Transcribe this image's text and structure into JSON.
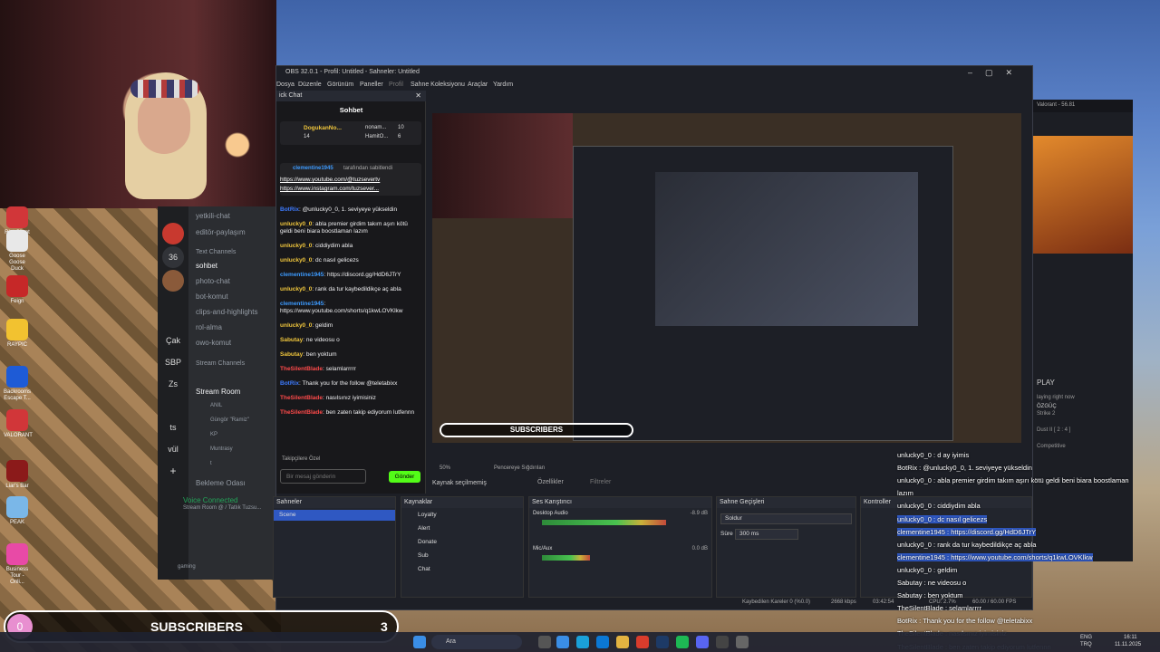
{
  "desktop": {
    "icons": [
      {
        "label": "Riot Client",
        "color": "#d13639"
      },
      {
        "label": "Goose Goose Duck",
        "color": "#e8e8e8"
      },
      {
        "label": "Feign",
        "color": "#c62828"
      },
      {
        "label": "RAYPIC",
        "color": "#f2c230"
      },
      {
        "label": "Backrooms Escape T...",
        "color": "#1e5bd6"
      },
      {
        "label": "VALORANT",
        "color": "#d13639"
      },
      {
        "label": "Liar's Bar",
        "color": "#8b1a1a"
      },
      {
        "label": "PEAK",
        "color": "#7ab7e8"
      },
      {
        "label": "Business Tour - Onli...",
        "color": "#e84aa6"
      }
    ]
  },
  "discord": {
    "servers": [
      "Çak",
      "36",
      "SBP",
      "Zs",
      "ts",
      "vül"
    ],
    "channels": [
      {
        "label": "yetkili-chat",
        "selected": false
      },
      {
        "label": "editör-paylaşım",
        "selected": false
      },
      {
        "label": "sohbet",
        "selected": true
      },
      {
        "label": "photo-chat",
        "selected": false
      },
      {
        "label": "bot-komut",
        "selected": false
      },
      {
        "label": "clips-and-highlights",
        "selected": false
      },
      {
        "label": "rol-alma",
        "selected": false
      },
      {
        "label": "owo-komut",
        "selected": false
      }
    ],
    "text_channels_label": "Text Channels",
    "stream_channels_label": "Stream Channels",
    "stream_room": "Stream Room",
    "voice_members": [
      "ANIL",
      "Güngör \"Ramiz\"",
      "KP",
      "Muntrasy",
      "t"
    ],
    "bekleme": "Bekleme Odası",
    "voice_connected": "Voice Connected",
    "voice_sub": "Stream Room @ / Tatlık Tuzsu...",
    "user_status": "gaming"
  },
  "obs": {
    "title": "OBS 32.0.1 - Profil: Untitled - Sahneler: Untitled",
    "menu": [
      "Dosya",
      "Düzenle",
      "Görünüm",
      "Paneller",
      "Profil",
      "Sahne Koleksiyonu",
      "Araçlar",
      "Yardım"
    ],
    "chat_dock_title": "ick Chat",
    "chat_header": "Sohbet",
    "leaderboard": [
      {
        "name": "DogukanNo...",
        "count": "14"
      },
      {
        "name": "nonam...",
        "count": "10"
      },
      {
        "name": "HamitO...",
        "count": "6"
      }
    ],
    "pinned": {
      "user": "clementine1945",
      "note": "tarafından sabitlendi",
      "link1": "https://www.youtube.com/@tuzsevertv",
      "link2": "https://www.instagram.com/tuzsever..."
    },
    "messages": [
      {
        "user": "BotRix",
        "color": "#3d7bff",
        "text": ": @unlucky0_0, 1. seviyeye yükseldin"
      },
      {
        "user": "unlucky0_0",
        "color": "#f0c63c",
        "text": ": abla premier girdim takım aşırı kötü geldi beni biara boostlaman lazım"
      },
      {
        "user": "unlucky0_0",
        "color": "#f0c63c",
        "text": ": ciddiydim abla"
      },
      {
        "user": "unlucky0_0",
        "color": "#f0c63c",
        "text": ": dc nasıl gelicezs"
      },
      {
        "user": "clementine1945",
        "color": "#3d9bff",
        "text": ": https://discord.gg/HdD6JTrY"
      },
      {
        "user": "unlucky0_0",
        "color": "#f0c63c",
        "text": ": rank da tur kaybedildikçe aç abla"
      },
      {
        "user": "clementine1945",
        "color": "#3d9bff",
        "text": ": https://www.youtube.com/shorts/q1kwLOVKlkw"
      },
      {
        "user": "unlucky0_0",
        "color": "#f0c63c",
        "text": ": geldim"
      },
      {
        "user": "Sabutay",
        "color": "#f0c63c",
        "text": ": ne videosu o"
      },
      {
        "user": "Sabutay",
        "color": "#f0c63c",
        "text": ": ben yoktum"
      },
      {
        "user": "TheSilentBlade",
        "color": "#ff4a4a",
        "text": ": selamlarrrrr"
      },
      {
        "user": "BotRix",
        "color": "#3d7bff",
        "text": ": Thank you for the follow @teletabixx"
      },
      {
        "user": "TheSilentBlade",
        "color": "#ff4a4a",
        "text": ": nasılsınız iyimisiniz"
      },
      {
        "user": "TheSilentBlade",
        "color": "#ff4a4a",
        "text": ": ben zaten takip ediyorum lutfennn"
      }
    ],
    "followers_label": "Takipçilere Özel",
    "input_placeholder": "Bir mesaj gönderin",
    "send_label": "Gönder",
    "status_row": {
      "zoom": "50%",
      "fit": "Pencereye Sığdırılan"
    },
    "source_status": "Kaynak seçilmemiş",
    "properties_label": "Özellikler",
    "filters_label": "Filtreler",
    "subscribers_label": "SUBSCRIBERS",
    "docks": {
      "scenes": {
        "title": "Sahneler",
        "items": [
          "Scene"
        ]
      },
      "sources": {
        "title": "Kaynaklar",
        "items": [
          "Loyalty",
          "Alert",
          "Donate",
          "Sub",
          "Chat"
        ]
      },
      "mixer": {
        "title": "Ses Karıştırıcı",
        "channels": [
          {
            "name": "Desktop Audio",
            "db": "-8.9 dB",
            "level": 0.78
          },
          {
            "name": "Mic/Aux",
            "db": "0.0 dB",
            "level": 0.3
          }
        ]
      },
      "transitions": {
        "title": "Sahne Geçişleri",
        "selected": "Soldur",
        "duration_label": "Süre",
        "duration": "300 ms"
      },
      "controls": {
        "title": "Kontroller"
      }
    },
    "statusbar": {
      "dropped": "Kaybedilen Kareler 0 (%0.0)",
      "bitrate": "2668 kbps",
      "time": "03:42:54",
      "cpu": "CPU: 2.7%",
      "fps": "60.00 / 60.00 FPS"
    }
  },
  "overlay_chat": [
    {
      "text": "unlucky0_0 : d ay iyimis",
      "hl": false
    },
    {
      "text": "BotRix : @unlucky0_0, 1. seviyeye yükseldin",
      "hl": false
    },
    {
      "text": "unlucky0_0 : abla premier girdim takım aşırı kötü geldi beni biara boostlaman",
      "hl": false
    },
    {
      "text": "lazım",
      "hl": false
    },
    {
      "text": "unlucky0_0 : ciddiydim abla",
      "hl": false
    },
    {
      "text": "unlucky0_0 : dc nasıl gelicezs",
      "hl": true
    },
    {
      "text": "clementine1945 : https://discord.gg/HdD6JTrY",
      "hl": true
    },
    {
      "text": "unlucky0_0 : rank da tur kaybedildikçe aç abla",
      "hl": false
    },
    {
      "text": "clementine1945 : https://www.youtube.com/shorts/q1kwLOVKlkw",
      "hl": true
    },
    {
      "text": "unlucky0_0 : geldim",
      "hl": false
    },
    {
      "text": "Sabutay : ne videosu o",
      "hl": false
    },
    {
      "text": "Sabutay : ben yoktum",
      "hl": false
    },
    {
      "text": "TheSilentBlade : selamlarrrr",
      "hl": false
    },
    {
      "text": "BotRix : Thank you for the follow @teletabixx",
      "hl": false
    },
    {
      "text": "TheSilentBlade : nasılsınız iyimisiniz",
      "hl": false
    },
    {
      "text": "TheSilentBlade : ben zaten takip ediyorum lutfennn",
      "hl": false
    }
  ],
  "overlay_subs": {
    "count_left": "0",
    "label": "SUBSCRIBERS",
    "count_right": "3"
  },
  "right_window": {
    "title": "Valorant - 56.81",
    "play": "PLAY",
    "line1": "laying right now",
    "line2": "ÖZGÜÇ",
    "line3": "Strike 2",
    "line4": "Dust II [ 2 : 4 ]",
    "line5": "Competitive"
  },
  "taskbar": {
    "search": "Ara",
    "lang": "ENG",
    "region": "TRQ",
    "time": "16:11",
    "date": "11.11.2025"
  }
}
